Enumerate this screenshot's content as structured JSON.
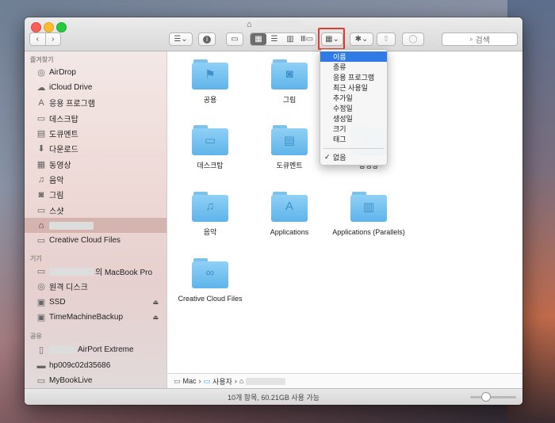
{
  "window": {
    "title_icon": "home-icon"
  },
  "toolbar": {
    "back": "‹",
    "forward": "›",
    "list_menu": "☰⌄",
    "info": "i",
    "new_folder": "▭",
    "view_icon": "▦",
    "view_list": "☰",
    "view_column": "▥",
    "view_coverflow": "Ⅲ▭",
    "arrange": "▦⌄",
    "action": "✱⌄",
    "share": "⇧",
    "tag": "◯",
    "search_icon": "🔍",
    "search_placeholder": "검색"
  },
  "sidebar": {
    "favorites_header": "즐겨찾기",
    "favorites": [
      {
        "label": "AirDrop",
        "icon": "airdrop-icon",
        "glyph": "◎"
      },
      {
        "label": "iCloud Drive",
        "icon": "cloud-icon",
        "glyph": "☁"
      },
      {
        "label": "응용 프로그램",
        "icon": "applications-icon",
        "glyph": "A"
      },
      {
        "label": "데스크탑",
        "icon": "desktop-icon",
        "glyph": "▭"
      },
      {
        "label": "도큐멘트",
        "icon": "documents-icon",
        "glyph": "▤"
      },
      {
        "label": "다운로드",
        "icon": "downloads-icon",
        "glyph": "⬇"
      },
      {
        "label": "동영상",
        "icon": "movies-icon",
        "glyph": "▦"
      },
      {
        "label": "음악",
        "icon": "music-icon",
        "glyph": "♫"
      },
      {
        "label": "그림",
        "icon": "camera-icon",
        "glyph": "◙"
      },
      {
        "label": "스샷",
        "icon": "folder-icon",
        "glyph": "▭"
      },
      {
        "label": "",
        "icon": "home-icon",
        "glyph": "⌂"
      },
      {
        "label": "Creative Cloud Files",
        "icon": "folder-icon",
        "glyph": "▭"
      }
    ],
    "devices_header": "기기",
    "devices": [
      {
        "label": "의 MacBook Pro",
        "icon": "laptop-icon",
        "glyph": "▭"
      },
      {
        "label": "원격 디스크",
        "icon": "disc-icon",
        "glyph": "◎"
      },
      {
        "label": "SSD",
        "icon": "drive-icon",
        "glyph": "▣",
        "eject": "⏏"
      },
      {
        "label": "TimeMachineBackup",
        "icon": "drive-icon",
        "glyph": "▣",
        "eject": "⏏"
      }
    ],
    "shared_header": "공유",
    "shared": [
      {
        "label": "AirPort Extreme",
        "icon": "router-icon",
        "glyph": "▯"
      },
      {
        "label": "hp009c02d35686",
        "icon": "monitor-icon",
        "glyph": "▬"
      },
      {
        "label": "MyBookLive",
        "icon": "monitor-icon",
        "glyph": "▭"
      }
    ]
  },
  "content": {
    "folders": [
      {
        "label": "공용",
        "glyph": "⚑"
      },
      {
        "label": "그림",
        "glyph": "◙"
      },
      {
        "label": "동영상",
        "glyph": "▦"
      },
      {
        "label": "데스크탑",
        "glyph": "▭"
      },
      {
        "label": "도큐멘트",
        "glyph": "▤"
      },
      {
        "label": "음악",
        "glyph": "♫"
      },
      {
        "label": "Applications",
        "glyph": "A"
      },
      {
        "label": "Applications (Parallels)",
        "glyph": "▥"
      },
      {
        "label": "Creative Cloud Files",
        "glyph": "∞"
      }
    ]
  },
  "menu": {
    "items": [
      "이름",
      "종류",
      "응용 프로그램",
      "최근 사용일",
      "추가일",
      "수정일",
      "생성일",
      "크기",
      "태그"
    ],
    "none_label": "없음",
    "none_check": "✓"
  },
  "pathbar": {
    "mac": "Mac",
    "users": "사용자",
    "sep": "›"
  },
  "status": {
    "text": "10개 항목, 60.21GB 사용 가능"
  },
  "colors": {
    "accent": "#2f7ae5",
    "folder": "#6cbdf0",
    "highlight": "#e33b2e"
  }
}
